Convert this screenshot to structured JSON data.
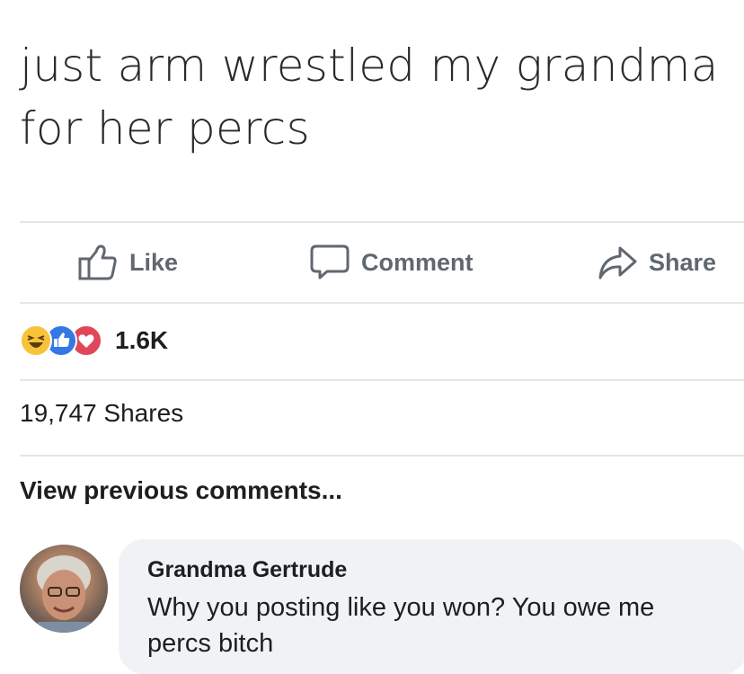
{
  "post": {
    "text_line1": "just arm wrestled my grandma",
    "text_line2": "for her percs"
  },
  "actions": {
    "like_label": "Like",
    "comment_label": "Comment",
    "share_label": "Share",
    "icon_color": "#606770"
  },
  "reactions": {
    "icons": [
      "haha-icon",
      "like-icon",
      "love-icon"
    ],
    "count": "1.6K"
  },
  "shares": {
    "text": "19,747 Shares"
  },
  "comments": {
    "view_previous": "View previous comments...",
    "items": [
      {
        "author": "Grandma Gertrude",
        "text": "Why you posting like you won? You owe me percs bitch"
      }
    ]
  }
}
